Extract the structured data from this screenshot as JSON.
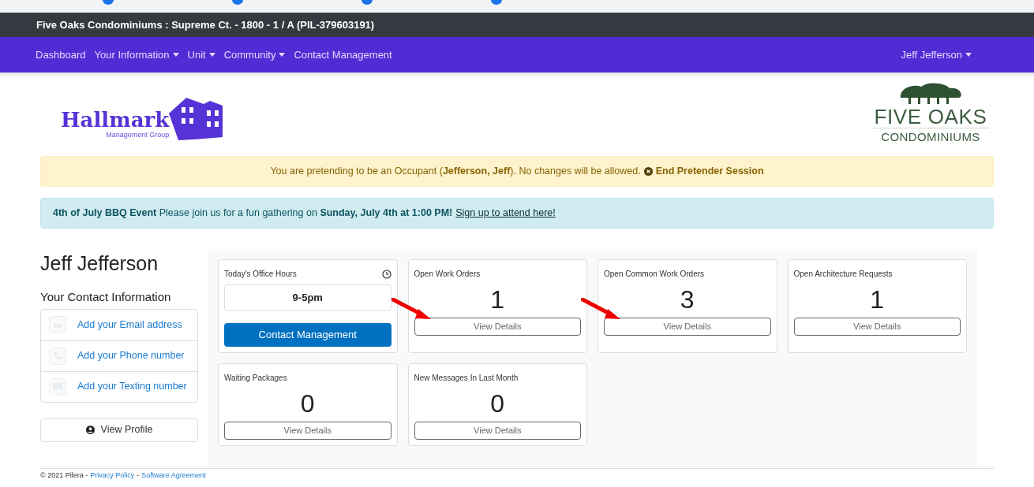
{
  "header": {
    "title": "Five Oaks Condominiums : Supreme Ct. - 1800 - 1 / A (PIL-379603191)"
  },
  "nav": {
    "items": [
      {
        "label": "Dashboard",
        "dropdown": false
      },
      {
        "label": "Your Information",
        "dropdown": true
      },
      {
        "label": "Unit",
        "dropdown": true
      },
      {
        "label": "Community",
        "dropdown": true
      },
      {
        "label": "Contact Management",
        "dropdown": false
      }
    ],
    "user": "Jeff Jefferson"
  },
  "logos": {
    "left": {
      "name": "Hallmark",
      "tagline": "Management Group"
    },
    "right": {
      "name": "FIVE OAKS",
      "tagline": "CONDOMINIUMS"
    }
  },
  "alerts": [
    {
      "kind": "warning",
      "text": "You are pretending to be an Occupant (**Jefferson, Jeff**). No changes will be allowed.",
      "action": "End Pretender Session"
    },
    {
      "kind": "info",
      "text": "**4th of July BBQ Event** Please join us for a fun gathering on **Sunday, July 4th at 1:00 PM!**",
      "action": "Sign up to attend here!"
    }
  ],
  "profile": {
    "name": "Jeff Jefferson",
    "contact_heading": "Your Contact Information",
    "contacts": [
      {
        "kind": "email",
        "label": "Add your Email address"
      },
      {
        "kind": "phone",
        "label": "Add your Phone number"
      },
      {
        "kind": "text",
        "label": "Add your Texting number"
      }
    ],
    "view_profile": "View Profile"
  },
  "cards": [
    {
      "kind": "hours",
      "title": "Today's Office Hours",
      "value": "9-5pm",
      "button": "Contact Management"
    },
    {
      "kind": "count",
      "title": "Open Work Orders",
      "value": "1",
      "button": "View Details",
      "arrow": true
    },
    {
      "kind": "count",
      "title": "Open Common Work Orders",
      "value": "3",
      "button": "View Details",
      "arrow": true
    },
    {
      "kind": "count",
      "title": "Open Architecture Requests",
      "value": "1",
      "button": "View Details",
      "arrow": false
    },
    {
      "kind": "count",
      "title": "Waiting Packages",
      "value": "0",
      "button": "View Details",
      "arrow": false
    },
    {
      "kind": "count",
      "title": "New Messages In Last Month",
      "value": "0",
      "button": "View Details",
      "arrow": false
    }
  ],
  "footer": {
    "copyright": "© 2021 Pilera -",
    "links": [
      "Privacy Policy",
      "Software Agreement"
    ],
    "separator": "-"
  }
}
